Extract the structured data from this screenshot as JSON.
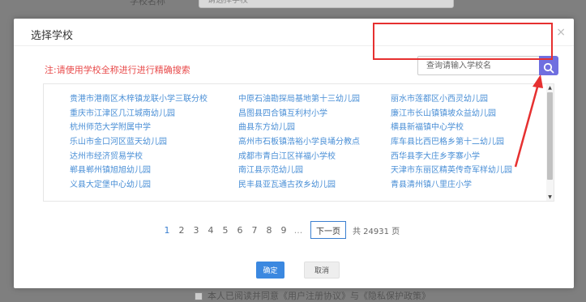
{
  "background": {
    "field_label": "学校名称",
    "input_placeholder": "请选择学校",
    "bottom_text": "本人已阅读并同意《用户注册协议》与《隐私保护政策》"
  },
  "dialog": {
    "title": "选择学校",
    "close_glyph": "×",
    "notice": "注:请使用学校全称进行进行精确搜索",
    "search": {
      "placeholder": "查询请输入学校名"
    },
    "schools": [
      "贵港市港南区木梓镇龙联小学三联分校",
      "中原石油勘探局基地第十三幼儿园",
      "丽水市莲都区小西灵幼儿园",
      "重庆市江津区几江城南幼儿园",
      "昌图县四合镇互利村小学",
      "廉江市长山镇镇坡众益幼儿园",
      "杭州师范大学附属中学",
      "曲县东方幼儿园",
      "横县新福镇中心学校",
      "乐山市金口河区蓝天幼儿园",
      "高州市石板镇浩裕小学良埇分教点",
      "库车县比西巴格乡第十二幼儿园",
      "达州市经济贸易学校",
      "成都市青白江区祥福小学校",
      "西华县李大庄乡李寨小学",
      "郸县郸州镇旭旭幼儿园",
      "南江县示范幼儿园",
      "天津市东丽区精英传奇军样幼儿园",
      "义县大定堡中心幼儿园",
      "民丰县亚瓦通古孜乡幼儿园",
      "青县清州镇八里庄小学"
    ],
    "pagination": {
      "pages": [
        "1",
        "2",
        "3",
        "4",
        "5",
        "6",
        "7",
        "8",
        "9"
      ],
      "ellipsis": "...",
      "next_label": "下一页",
      "total_text": "共 24931 页"
    },
    "confirm_label": "确定",
    "cancel_label": "取消"
  },
  "colors": {
    "accent": "#3b88e0",
    "search_button": "#6f6fe0",
    "notice_red": "#e84a4a",
    "annotation_red": "#e63030",
    "link_blue": "#4a8fd6"
  },
  "icons": {
    "search": "search-icon",
    "close": "close-icon",
    "scroll_up": "triangle-up-icon",
    "scroll_down": "triangle-down-icon"
  }
}
